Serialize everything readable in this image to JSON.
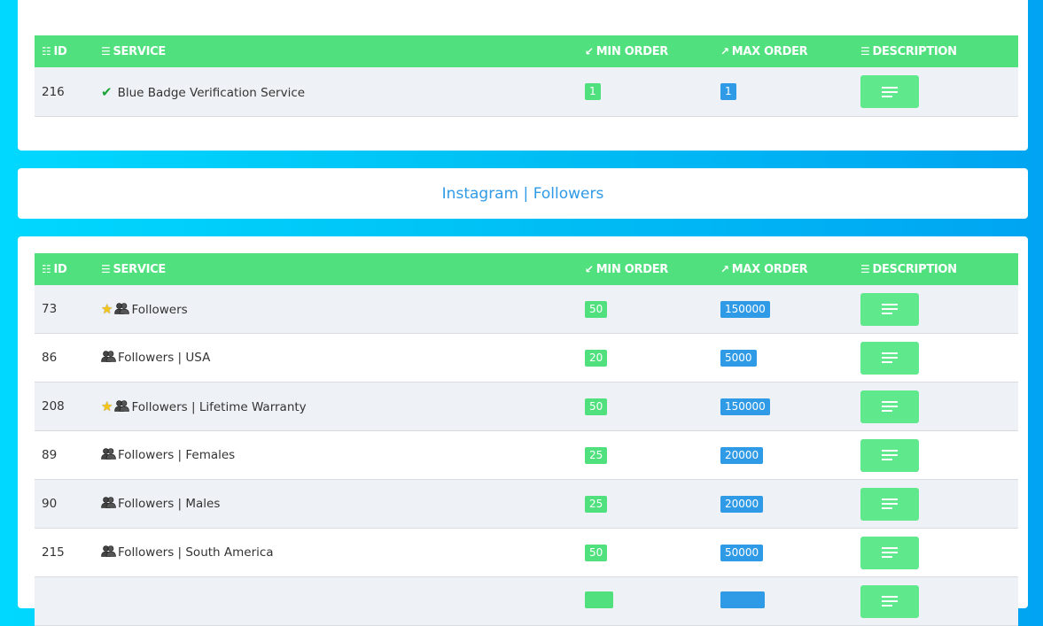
{
  "headers": {
    "id": "ID",
    "service": "SERVICE",
    "min_order": "MIN ORDER",
    "max_order": "MAX ORDER",
    "description": "DESCRIPTION"
  },
  "top_table": {
    "rows": [
      {
        "id": "216",
        "name": "Blue Badge Verification Service",
        "min": "1",
        "max": "1"
      }
    ]
  },
  "category": {
    "title": "Instagram | Followers"
  },
  "main_table": {
    "rows": [
      {
        "id": "73",
        "name": "Followers",
        "min": "50",
        "max": "150000",
        "star": true
      },
      {
        "id": "86",
        "name": "Followers | USA",
        "min": "20",
        "max": "5000",
        "star": false
      },
      {
        "id": "208",
        "name": "Followers | Lifetime Warranty",
        "min": "50",
        "max": "150000",
        "star": true
      },
      {
        "id": "89",
        "name": "Followers | Females",
        "min": "25",
        "max": "20000",
        "star": false
      },
      {
        "id": "90",
        "name": "Followers | Males",
        "min": "25",
        "max": "20000",
        "star": false
      },
      {
        "id": "215",
        "name": "Followers | South America",
        "min": "50",
        "max": "50000",
        "star": false
      },
      {
        "id": "",
        "name": "",
        "min": "",
        "max": "",
        "star": false
      }
    ]
  },
  "colors": {
    "header_green": "#50e07e",
    "min_badge": "#50e07e",
    "max_badge": "#2f9ae6",
    "category_text": "#2f9ae6"
  }
}
